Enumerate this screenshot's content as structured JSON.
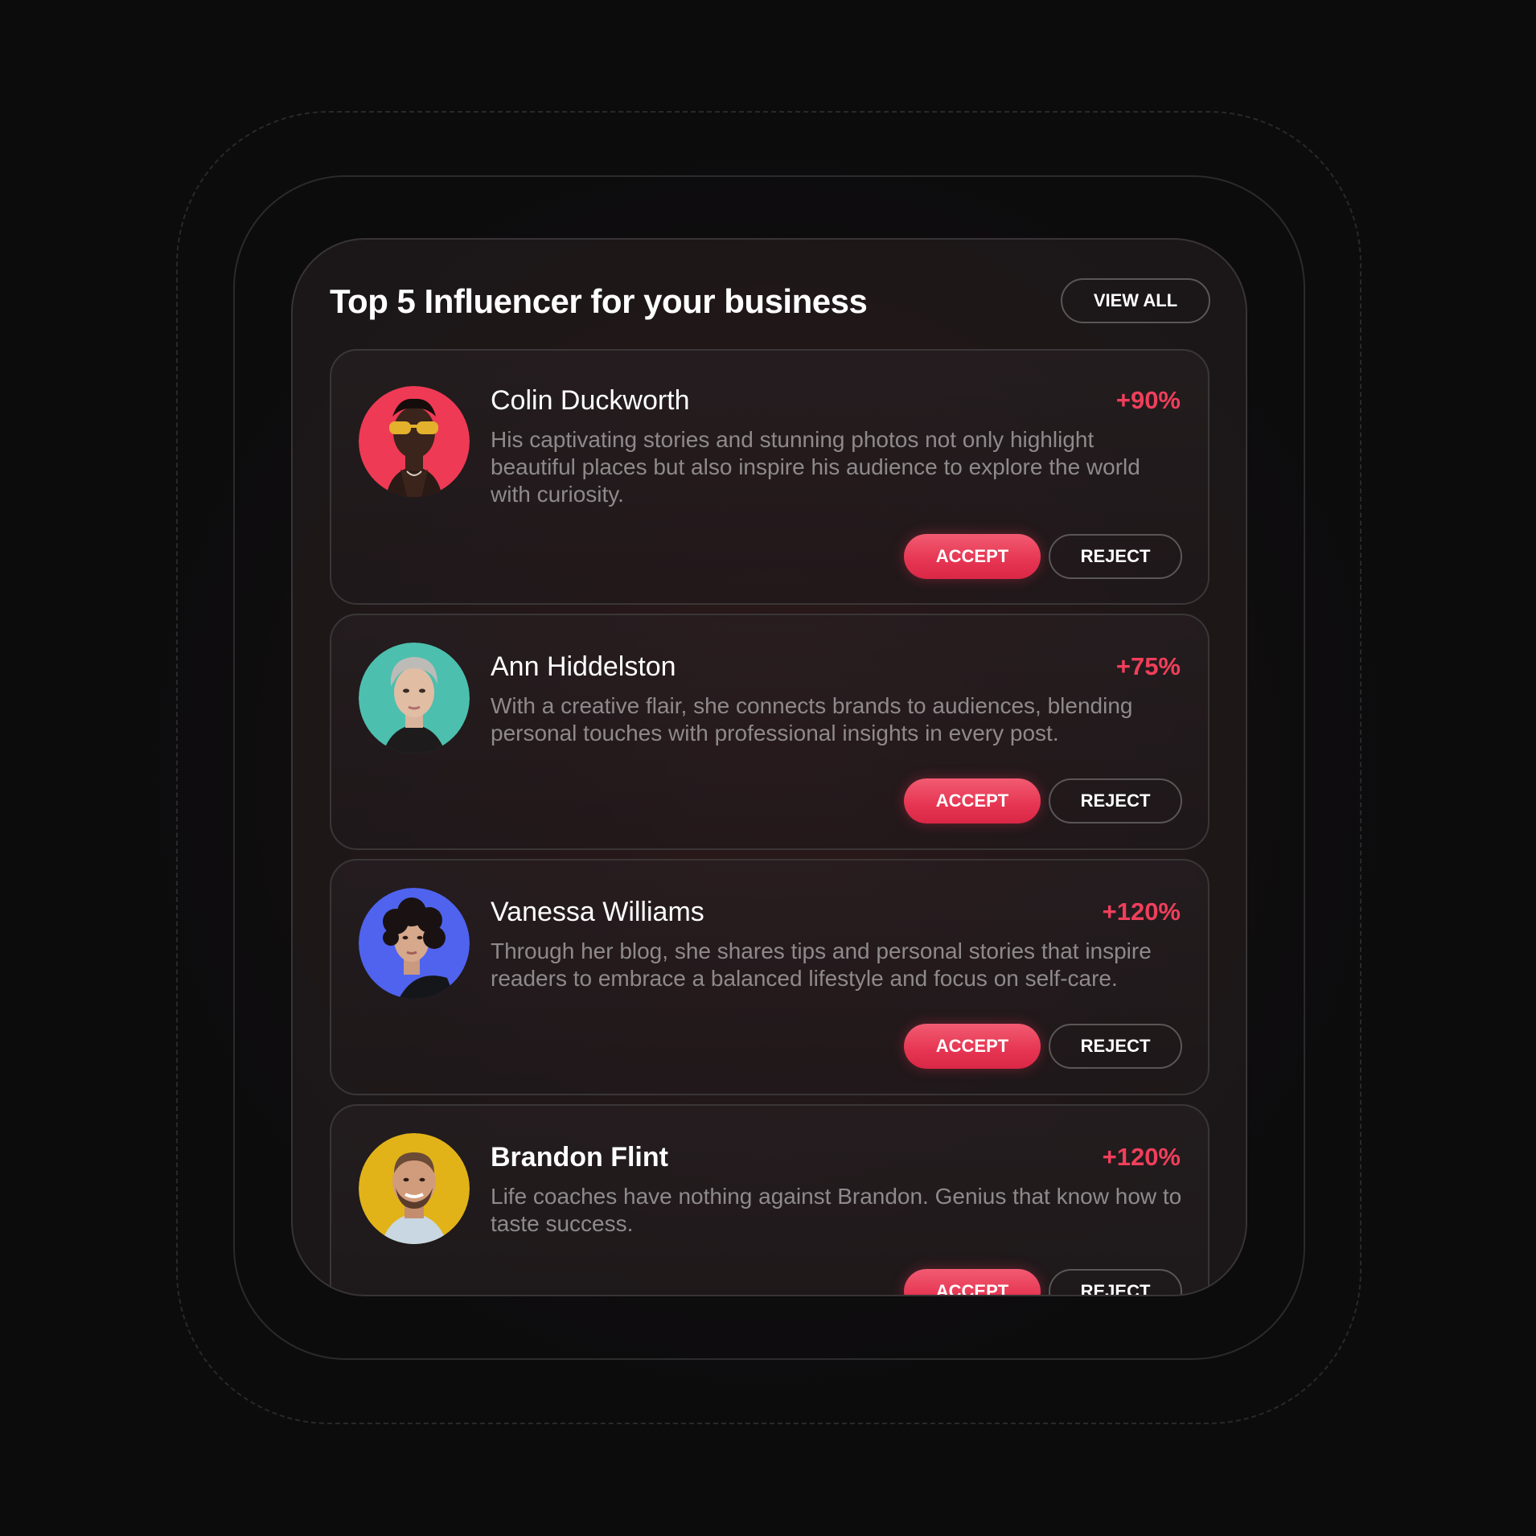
{
  "header": {
    "title": "Top 5 Influencer for your business",
    "view_all_label": "VIEW ALL"
  },
  "colors": {
    "accent": "#E63552",
    "growth_text": "#EF3F5B",
    "description_text": "#8E8A8B"
  },
  "influencers": [
    {
      "name": "Colin Duckworth",
      "growth": "+90%",
      "description": "His captivating stories and stunning photos not only highlight beautiful places but also inspire his audience to explore the world with curiosity.",
      "avatar_bg": "#EF3A55",
      "accept_label": "ACCEPT",
      "reject_label": "REJECT"
    },
    {
      "name": "Ann Hiddelston",
      "growth": "+75%",
      "description": "With a creative flair, she connects brands to audiences, blending personal touches with professional insights in every post.",
      "avatar_bg": "#4DBFAE",
      "accept_label": "ACCEPT",
      "reject_label": "REJECT"
    },
    {
      "name": "Vanessa Williams",
      "growth": "+120%",
      "description": "Through her blog, she shares tips and personal stories that inspire readers to embrace a balanced lifestyle and focus on self-care.",
      "avatar_bg": "#4F63EE",
      "accept_label": "ACCEPT",
      "reject_label": "REJECT"
    },
    {
      "name": "Brandon Flint",
      "growth": "+120%",
      "description": "Life coaches have nothing against Brandon. Genius that know how to taste success.",
      "avatar_bg": "#E2B319",
      "accept_label": "ACCEPT",
      "reject_label": "REJECT"
    }
  ]
}
